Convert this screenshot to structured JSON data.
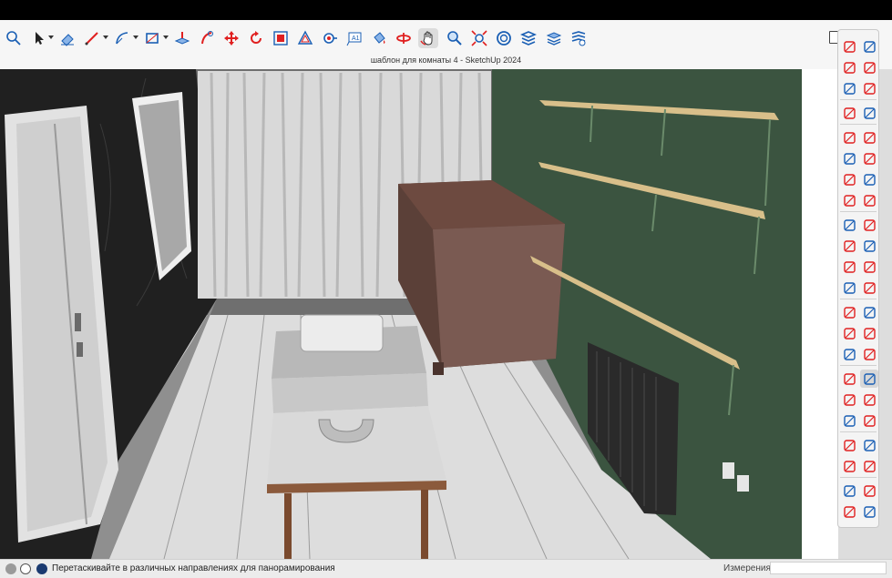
{
  "window": {
    "title": "шаблон для комнаты 4 - SketchUp 2024"
  },
  "toolbar": {
    "tools": [
      {
        "name": "search-icon",
        "label": "Search"
      },
      {
        "name": "select-icon",
        "label": "Select"
      },
      {
        "name": "eraser-icon",
        "label": "Eraser"
      },
      {
        "name": "line-icon",
        "label": "Line"
      },
      {
        "name": "arc-icon",
        "label": "Arc"
      },
      {
        "name": "rectangle-icon",
        "label": "Rectangle"
      },
      {
        "name": "push-pull-icon",
        "label": "Push/Pull"
      },
      {
        "name": "follow-me-icon",
        "label": "Follow Me"
      },
      {
        "name": "move-icon",
        "label": "Move"
      },
      {
        "name": "rotate-icon",
        "label": "Rotate"
      },
      {
        "name": "scale-icon",
        "label": "Scale"
      },
      {
        "name": "offset-icon",
        "label": "Offset"
      },
      {
        "name": "tape-measure-icon",
        "label": "Tape Measure"
      },
      {
        "name": "text-icon",
        "label": "Text"
      },
      {
        "name": "paint-bucket-icon",
        "label": "Paint Bucket"
      },
      {
        "name": "orbit-icon",
        "label": "Orbit"
      },
      {
        "name": "pan-icon",
        "label": "Pan"
      },
      {
        "name": "zoom-icon",
        "label": "Zoom"
      },
      {
        "name": "zoom-extents-icon",
        "label": "Zoom Extents"
      },
      {
        "name": "3d-warehouse-icon",
        "label": "3D Warehouse"
      },
      {
        "name": "extension-warehouse-icon",
        "label": "Extension Warehouse"
      },
      {
        "name": "layout-icon",
        "label": "LayOut"
      },
      {
        "name": "extension-manager-icon",
        "label": "Extension Manager"
      }
    ],
    "active_tool": "pan-icon"
  },
  "right_panel": {
    "tools": [
      "select-icon",
      "lasso-icon",
      "paint-bucket-icon",
      "eraser-icon",
      "tag-icon",
      "edit-icon",
      "line-icon",
      "freehand-icon",
      "rectangle-icon",
      "rotated-rectangle-icon",
      "circle-icon",
      "polygon-icon",
      "arc-icon",
      "two-point-arc-icon",
      "three-point-arc-icon",
      "pie-icon",
      "move-icon",
      "push-pull-icon",
      "rotate-icon",
      "follow-me-icon",
      "scale-icon",
      "offset-icon",
      "flip-icon",
      "section-plane-icon",
      "tape-measure-icon",
      "dimension-icon",
      "protractor-icon",
      "text-icon",
      "axes-icon",
      "3d-text-icon",
      "orbit-icon",
      "pan-icon",
      "zoom-icon",
      "zoom-window-icon",
      "zoom-extents-icon",
      "previous-view-icon",
      "position-camera-icon",
      "walk-icon",
      "look-around-icon",
      "section-icon",
      "3d-warehouse-icon",
      "extension-warehouse-icon",
      "layout-icon",
      "extension-manager-icon"
    ],
    "active_tool": "pan-icon"
  },
  "status": {
    "hint": "Перетаскивайте в различных направлениях для панорамирования",
    "measurements_label": "Измерения",
    "measurements_value": ""
  },
  "colors": {
    "accent": "#1a6fc4",
    "tool_red": "#e02020",
    "tool_blue": "#1a5fb4",
    "wall_green": "#3b5440",
    "wall_dark": "#1f1f1f",
    "floor": "#8c8c8c",
    "shelf_wood": "#d8bf8a"
  }
}
